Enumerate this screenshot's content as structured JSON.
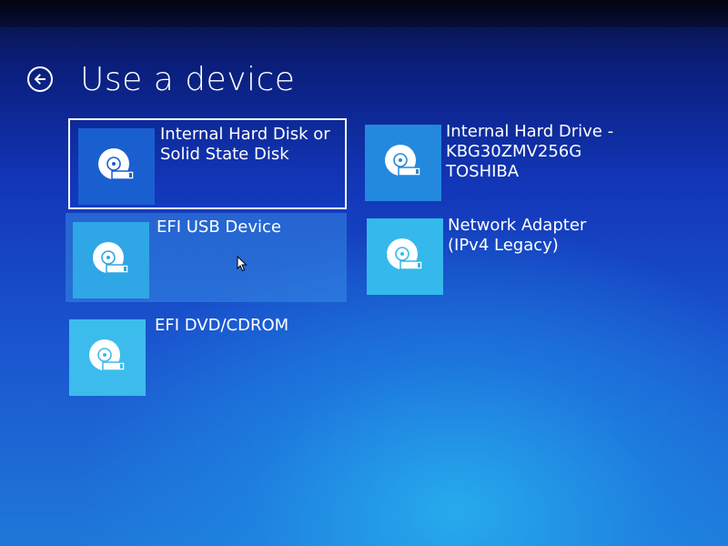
{
  "page": {
    "title": "Use a device"
  },
  "devices": [
    {
      "label": "Internal Hard Disk or\nSolid State Disk",
      "icon": "disk-icon",
      "state": "selected"
    },
    {
      "label": "Internal Hard Drive -\nKBG30ZMV256G\nTOSHIBA",
      "icon": "disk-icon",
      "state": "normal"
    },
    {
      "label": "EFI USB Device",
      "icon": "disk-icon",
      "state": "hover"
    },
    {
      "label": "Network Adapter\n(IPv4 Legacy)",
      "icon": "disk-icon",
      "state": "normal"
    },
    {
      "label": "EFI DVD/CDROM",
      "icon": "disk-icon",
      "state": "normal"
    }
  ],
  "colors": {
    "tile_1": "#1a5fd0",
    "tile_2": "#2389de",
    "tile_3": "#2fa6e6",
    "tile_4": "#35b8ec",
    "tile_5": "#3cbcec",
    "icon_fill": "#ffffff"
  }
}
